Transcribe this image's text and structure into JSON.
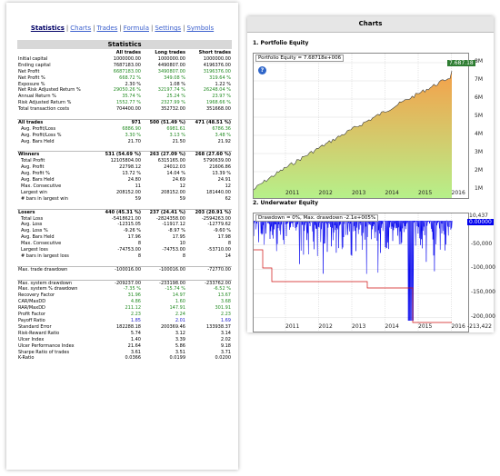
{
  "nav": {
    "items": [
      "Statistics",
      "Charts",
      "Trades",
      "Formula",
      "Settings",
      "Symbols"
    ],
    "active": "Statistics"
  },
  "stats": {
    "title": "Statistics",
    "columns": [
      "All trades",
      "Long trades",
      "Short trades"
    ],
    "rows": [
      {
        "label": "Initial capital",
        "v": [
          "1000000.00",
          "1000000.00",
          "1000000.00"
        ]
      },
      {
        "label": "Ending capital",
        "v": [
          "7687183.00",
          "4490807.00",
          "4196376.00"
        ]
      },
      {
        "label": "Net Profit",
        "v": [
          "6687183.00",
          "3490807.00",
          "3196376.00"
        ],
        "cls": "g"
      },
      {
        "label": "Net Profit %",
        "v": [
          "668.72 %",
          "349.08 %",
          "319.64 %"
        ],
        "cls": "g"
      },
      {
        "label": "Exposure %",
        "v": [
          "2.30 %",
          "1.08 %",
          "1.22 %"
        ]
      },
      {
        "label": "Net Risk Adjusted Return %",
        "v": [
          "29050.26 %",
          "32197.74 %",
          "26248.04 %"
        ],
        "cls": "g"
      },
      {
        "label": "Annual Return %",
        "v": [
          "35.74 %",
          "25.24 %",
          "23.97 %"
        ],
        "cls": "g"
      },
      {
        "label": "Risk Adjusted Return %",
        "v": [
          "1552.77 %",
          "2327.99 %",
          "1968.66 %"
        ],
        "cls": "g"
      },
      {
        "label": "Total transaction costs",
        "v": [
          "704400.00",
          "352732.00",
          "351668.00"
        ]
      },
      {
        "label": "",
        "v": [
          "",
          "",
          ""
        ],
        "sp": true
      },
      {
        "label": "All trades",
        "v": [
          "971",
          "500 (51.49 %)",
          "471 (48.51 %)"
        ],
        "bold": true,
        "sec": true
      },
      {
        "label": "Avg. Profit/Loss",
        "v": [
          "6886.90",
          "6981.61",
          "6786.36"
        ],
        "cls": "g",
        "ind": true
      },
      {
        "label": "Avg. Profit/Loss %",
        "v": [
          "3.30 %",
          "3.13 %",
          "3.48 %"
        ],
        "cls": "g",
        "ind": true
      },
      {
        "label": "Avg. Bars Held",
        "v": [
          "21.70",
          "21.50",
          "21.92"
        ],
        "ind": true
      },
      {
        "label": "",
        "v": [
          "",
          "",
          ""
        ],
        "sp": true
      },
      {
        "label": "Winners",
        "v": [
          "531 (54.69 %)",
          "263 (27.09 %)",
          "268 (27.60 %)"
        ],
        "bold": true,
        "sec": true
      },
      {
        "label": "Total Profit",
        "v": [
          "12105804.00",
          "6315165.00",
          "5790639.00"
        ],
        "ind": true
      },
      {
        "label": "Avg. Profit",
        "v": [
          "22798.12",
          "24012.03",
          "21606.86"
        ],
        "ind": true
      },
      {
        "label": "Avg. Profit %",
        "v": [
          "13.72 %",
          "14.04 %",
          "13.39 %"
        ],
        "ind": true
      },
      {
        "label": "Avg. Bars Held",
        "v": [
          "24.80",
          "24.69",
          "24.91"
        ],
        "ind": true
      },
      {
        "label": "Max. Consecutive",
        "v": [
          "11",
          "12",
          "12"
        ],
        "ind": true
      },
      {
        "label": "Largest win",
        "v": [
          "208152.00",
          "208152.00",
          "181440.00"
        ],
        "ind": true
      },
      {
        "label": "# bars in largest win",
        "v": [
          "59",
          "59",
          "62"
        ],
        "ind": true
      },
      {
        "label": "",
        "v": [
          "",
          "",
          ""
        ],
        "sp": true
      },
      {
        "label": "Losers",
        "v": [
          "440 (45.31 %)",
          "237 (24.41 %)",
          "203 (20.91 %)"
        ],
        "bold": true,
        "sec": true
      },
      {
        "label": "Total Loss",
        "v": [
          "-5418621.00",
          "-2824358.00",
          "-2594263.00"
        ],
        "ind": true
      },
      {
        "label": "Avg. Loss",
        "v": [
          "-12315.05",
          "-11917.12",
          "-12779.62"
        ],
        "ind": true
      },
      {
        "label": "Avg. Loss %",
        "v": [
          "-9.26 %",
          "-8.97 %",
          "-9.60 %"
        ],
        "ind": true
      },
      {
        "label": "Avg. Bars Held",
        "v": [
          "17.96",
          "17.95",
          "17.98"
        ],
        "ind": true
      },
      {
        "label": "Max. Consecutive",
        "v": [
          "8",
          "10",
          "8"
        ],
        "ind": true
      },
      {
        "label": "Largest loss",
        "v": [
          "-74753.00",
          "-74753.00",
          "-53710.00"
        ],
        "ind": true
      },
      {
        "label": "# bars in largest loss",
        "v": [
          "8",
          "8",
          "14"
        ],
        "ind": true
      },
      {
        "label": "",
        "v": [
          "",
          "",
          ""
        ],
        "sp": true
      },
      {
        "label": "Max. trade drawdown",
        "v": [
          "-100016.00",
          "-100016.00",
          "-72770.00"
        ],
        "sec": true
      },
      {
        "label": "",
        "v": [
          "",
          "",
          ""
        ],
        "sp": true
      },
      {
        "label": "Max. system drawdown",
        "v": [
          "-209237.00",
          "-233198.00",
          "-233762.00"
        ],
        "sec": true
      },
      {
        "label": "Max. system % drawdown",
        "v": [
          "-7.35 %",
          "-15.74 %",
          "-6.52 %"
        ],
        "cls": "g"
      },
      {
        "label": "Recovery Factor",
        "v": [
          "31.96",
          "14.97",
          "13.67"
        ],
        "cls": "g"
      },
      {
        "label": "CAR/MaxDD",
        "v": [
          "4.86",
          "1.60",
          "3.68"
        ],
        "cls": "g"
      },
      {
        "label": "RAR/MaxDD",
        "v": [
          "211.12",
          "147.91",
          "301.91"
        ],
        "cls": "g"
      },
      {
        "label": "Profit Factor",
        "v": [
          "2.23",
          "2.24",
          "2.23"
        ],
        "cls": "g"
      },
      {
        "label": "Payoff Ratio",
        "v": [
          "1.85",
          "2.01",
          "1.69"
        ],
        "cls": "b"
      },
      {
        "label": "Standard Error",
        "v": [
          "182288.18",
          "200369.46",
          "133938.37"
        ]
      },
      {
        "label": "Risk-Reward Ratio",
        "v": [
          "5.74",
          "3.12",
          "3.14"
        ]
      },
      {
        "label": "Ulcer Index",
        "v": [
          "1.40",
          "3.39",
          "2.02"
        ]
      },
      {
        "label": "Ulcer Performance Index",
        "v": [
          "21.64",
          "5.86",
          "9.18"
        ]
      },
      {
        "label": "Sharpe Ratio of trades",
        "v": [
          "3.61",
          "3.51",
          "3.71"
        ]
      },
      {
        "label": "K-Ratio",
        "v": [
          "0.0366",
          "0.0199",
          "0.0200"
        ]
      }
    ]
  },
  "charts": {
    "title": "Charts",
    "equity": {
      "title": "1. Portfolio Equity",
      "legend": "Portfolio Equity = 7.68718e+006",
      "help": "?",
      "last_value": "7.687.18",
      "y_ticks": [
        "8M",
        "7M",
        "6M",
        "5M",
        "4M",
        "3M",
        "2M",
        "1M"
      ],
      "x_ticks": [
        "2011",
        "2012",
        "2013",
        "2014",
        "2015",
        "2016"
      ],
      "colors": {
        "fill_top": "#f5a04a",
        "fill_bottom": "#b6f08a",
        "line": "#3d3d3d",
        "label_bg": "#2e7d32"
      }
    },
    "underwater": {
      "title": "2. Underwater Equity",
      "legend": "Drawdown = 0%, Max. drawdown -2.1e+005%",
      "last_value": "0.00000",
      "top_label": "10,437",
      "bottom_label": "-213,422",
      "y_ticks": [
        "-50,000",
        "-100,000",
        "-150,000",
        "-200,000"
      ],
      "x_ticks": [
        "2011",
        "2012",
        "2013",
        "2014",
        "2015",
        "2016"
      ],
      "colors": {
        "bars": "#0000ee",
        "line": "#d01010",
        "label_bg": "#0000ee"
      }
    }
  }
}
